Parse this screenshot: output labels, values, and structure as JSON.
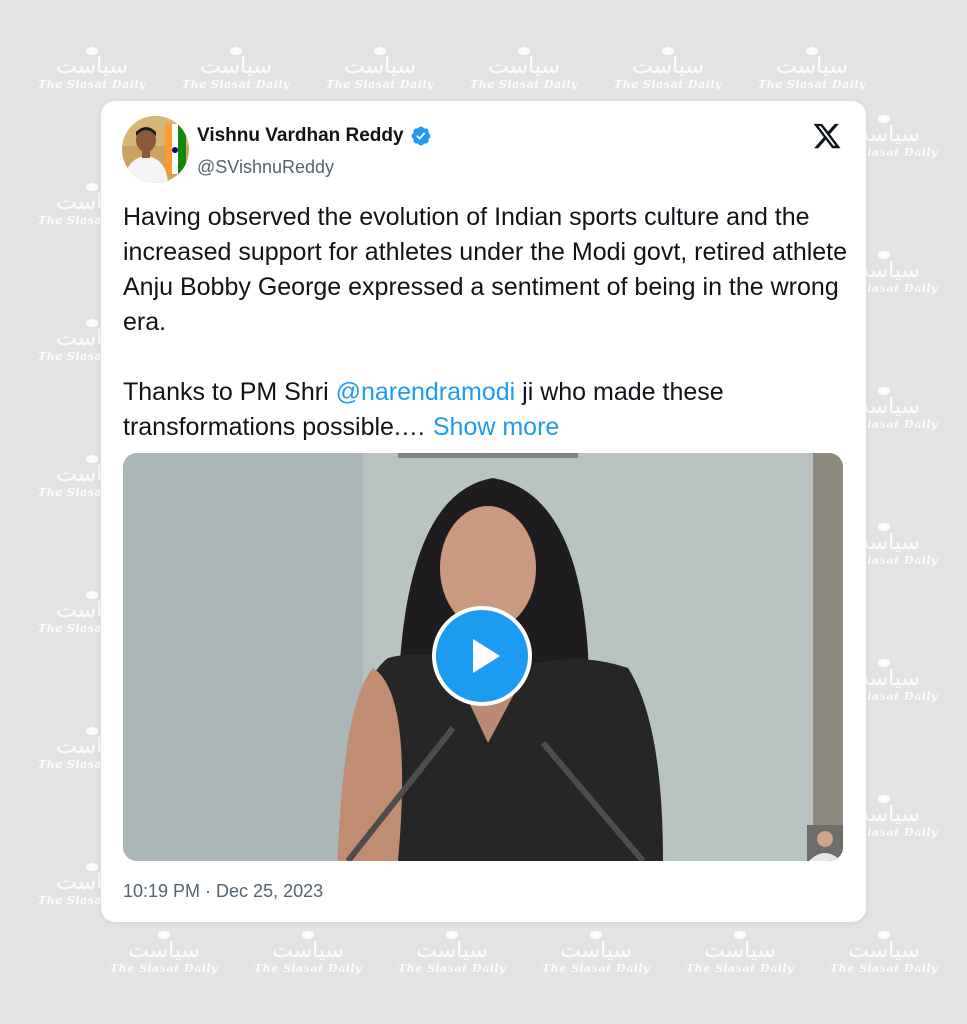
{
  "background": {
    "watermark": {
      "urdu": "سیاست",
      "english": "The Siasat Daily"
    }
  },
  "tweet": {
    "author": {
      "name": "Vishnu Vardhan Reddy",
      "handle": "@SVishnuReddy",
      "verified": true
    },
    "platform_icon": "x-logo-icon",
    "text": {
      "paragraph1": "Having observed the evolution of Indian sports culture and the increased support for athletes under the Modi govt, retired athlete Anju Bobby George expressed a sentiment of being in the wrong era.",
      "paragraph2_prefix": "Thanks to PM Shri ",
      "mention": "@narendramodi",
      "paragraph2_suffix": " ji who made these transformations possible.… ",
      "show_more": "Show more"
    },
    "media": {
      "type": "video",
      "play_icon": "play-icon"
    },
    "timestamp": "10:19 PM · Dec 25, 2023"
  },
  "colors": {
    "accent": "#1d9bf0",
    "text_primary": "#0f1419",
    "text_secondary": "#536471",
    "page_background": "#e3e3e3"
  }
}
